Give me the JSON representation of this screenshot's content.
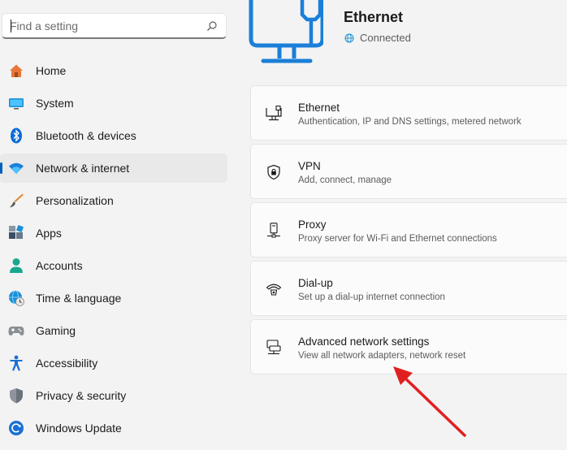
{
  "search": {
    "placeholder": "Find a setting",
    "icon": "search-icon"
  },
  "sidebar": {
    "active_index": 3,
    "items": [
      {
        "label": "Home",
        "icon": "home-icon"
      },
      {
        "label": "System",
        "icon": "monitor-icon"
      },
      {
        "label": "Bluetooth & devices",
        "icon": "bluetooth-icon"
      },
      {
        "label": "Network & internet",
        "icon": "wifi-icon"
      },
      {
        "label": "Personalization",
        "icon": "brush-icon"
      },
      {
        "label": "Apps",
        "icon": "apps-icon"
      },
      {
        "label": "Accounts",
        "icon": "person-icon"
      },
      {
        "label": "Time & language",
        "icon": "clock-globe-icon"
      },
      {
        "label": "Gaming",
        "icon": "gamepad-icon"
      },
      {
        "label": "Accessibility",
        "icon": "accessibility-icon"
      },
      {
        "label": "Privacy & security",
        "icon": "shield-icon"
      },
      {
        "label": "Windows Update",
        "icon": "update-icon"
      }
    ]
  },
  "header": {
    "title": "Ethernet",
    "status": "Connected",
    "hero_icon": "ethernet-monitor-icon"
  },
  "cards": [
    {
      "title": "Ethernet",
      "subtitle": "Authentication, IP and DNS settings, metered network",
      "icon": "ethernet-icon"
    },
    {
      "title": "VPN",
      "subtitle": "Add, connect, manage",
      "icon": "vpn-shield-icon"
    },
    {
      "title": "Proxy",
      "subtitle": "Proxy server for Wi-Fi and Ethernet connections",
      "icon": "proxy-icon"
    },
    {
      "title": "Dial-up",
      "subtitle": "Set up a dial-up internet connection",
      "icon": "dialup-icon"
    },
    {
      "title": "Advanced network settings",
      "subtitle": "View all network adapters, network reset",
      "icon": "network-adapter-icon"
    }
  ],
  "colors": {
    "accent": "#005fb8",
    "annotation_arrow": "#e02020"
  }
}
